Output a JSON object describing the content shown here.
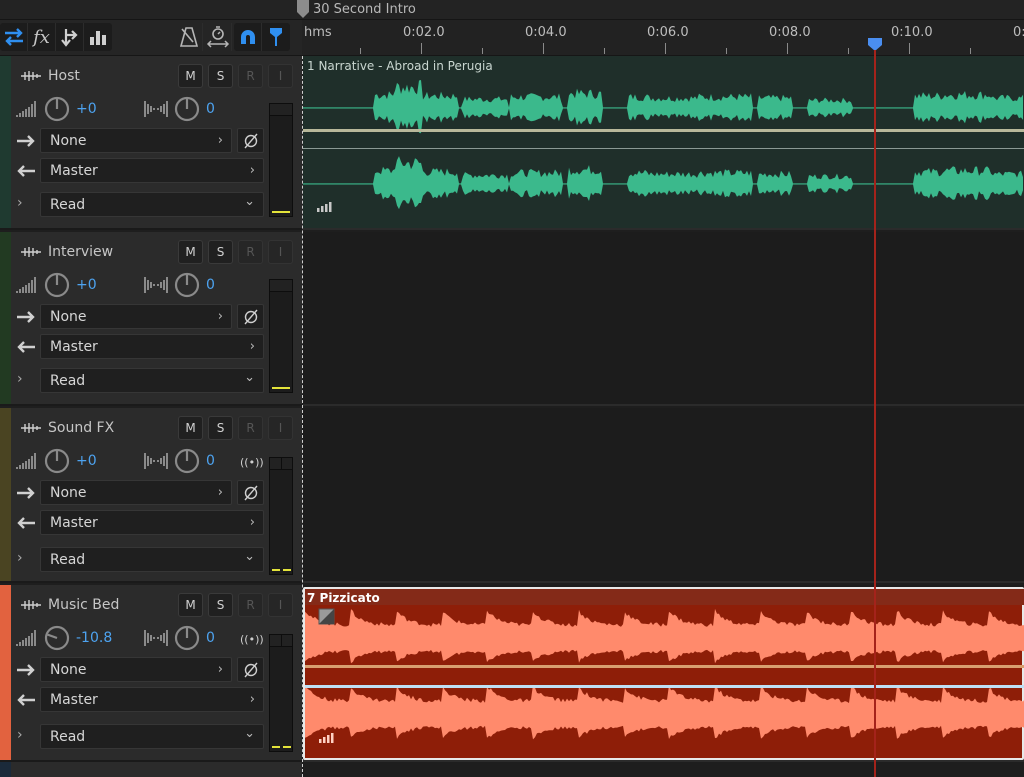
{
  "sequence": {
    "title": "30 Second Intro"
  },
  "toolbar": {
    "left_icons": [
      "swap-icon",
      "fx-icon",
      "routing-icon",
      "bar-chart-icon"
    ],
    "right_icons": [
      "metronome-icon",
      "stopwatch-icon",
      "snap-magnet-icon",
      "marker-pin-icon"
    ],
    "active": [
      "snap-magnet-icon",
      "marker-pin-icon"
    ],
    "accent": "#2f8ff0"
  },
  "ruler": {
    "unit": "hms",
    "labels": [
      "0:02.0",
      "0:04.0",
      "0:06.0",
      "0:08.0",
      "0:10.0",
      "0:1"
    ],
    "playhead_time_sec": 9.4,
    "playhead_color": "#a4231b"
  },
  "tracks": [
    {
      "name": "Host",
      "color": "#1f3a30",
      "buttons": [
        "M",
        "S",
        "R",
        "I"
      ],
      "volume": "+0",
      "pan": "0",
      "input": "None",
      "output": "Master",
      "automation": "Read",
      "stereo_icon": false,
      "clip": {
        "title": "1 Narrative - Abroad in Perugia",
        "bg": "#1f2f2a",
        "wave": "#3bb98c"
      }
    },
    {
      "name": "Interview",
      "color": "#223a22",
      "buttons": [
        "M",
        "S",
        "R",
        "I"
      ],
      "volume": "+0",
      "pan": "0",
      "input": "None",
      "output": "Master",
      "automation": "Read",
      "stereo_icon": false,
      "clip": null
    },
    {
      "name": "Sound FX",
      "color": "#4a4422",
      "buttons": [
        "M",
        "S",
        "R",
        "I"
      ],
      "volume": "+0",
      "pan": "0",
      "input": "None",
      "output": "Master",
      "automation": "Read",
      "stereo_icon": true,
      "radio_symbol": "((•))",
      "clip": null
    },
    {
      "name": "Music Bed",
      "color": "#e2623f",
      "buttons": [
        "M",
        "S",
        "R",
        "I"
      ],
      "volume": "-10.8",
      "pan": "0",
      "input": "None",
      "output": "Master",
      "automation": "Read",
      "stereo_icon": true,
      "radio_symbol": "((•))",
      "clip": {
        "title": "7 Pizzicato",
        "bg": "#8e1e08",
        "wave": "#ff8a6c"
      }
    }
  ],
  "glyphs": {
    "chevron_right": "›",
    "chevron_down": "⌄",
    "expand": "›"
  }
}
